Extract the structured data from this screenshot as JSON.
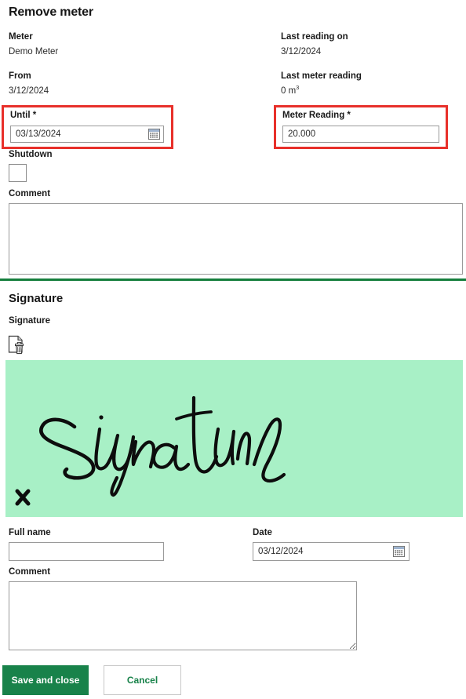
{
  "page": {
    "title": "Remove meter"
  },
  "meter_section": {
    "meter": {
      "label": "Meter",
      "value": "Demo Meter"
    },
    "from": {
      "label": "From",
      "value": "3/12/2024"
    },
    "last_reading_on": {
      "label": "Last reading on",
      "value": "3/12/2024"
    },
    "last_meter_reading": {
      "label": "Last meter reading",
      "value": "0 m",
      "unit_exponent": "3"
    },
    "until": {
      "label": "Until *",
      "value": "03/13/2024",
      "placeholder": "",
      "icon": "calendar-icon",
      "highlighted": true
    },
    "meter_reading": {
      "label": "Meter Reading *",
      "value": "20.000",
      "placeholder": "",
      "highlighted": true
    },
    "shutdown": {
      "label": "Shutdown",
      "checked": false
    },
    "comment": {
      "label": "Comment",
      "value": "",
      "placeholder": ""
    }
  },
  "signature_section": {
    "heading": "Signature",
    "signature_label": "Signature",
    "delete_icon": "document-delete-icon",
    "canvas": {
      "text": "Signature",
      "mark": "✗",
      "background_color": "#a8f0c6",
      "ink_color": "#0d0d0d"
    },
    "full_name": {
      "label": "Full name",
      "value": "",
      "placeholder": ""
    },
    "date": {
      "label": "Date",
      "value": "03/12/2024",
      "placeholder": "",
      "icon": "calendar-icon"
    },
    "comment": {
      "label": "Comment",
      "value": "",
      "placeholder": ""
    }
  },
  "footer": {
    "save_label": "Save and close",
    "cancel_label": "Cancel"
  },
  "colors": {
    "accent_green": "#18824a",
    "divider_green": "#157f3d",
    "annotation_red": "#e8302a",
    "signature_bg": "#a8f0c6"
  }
}
